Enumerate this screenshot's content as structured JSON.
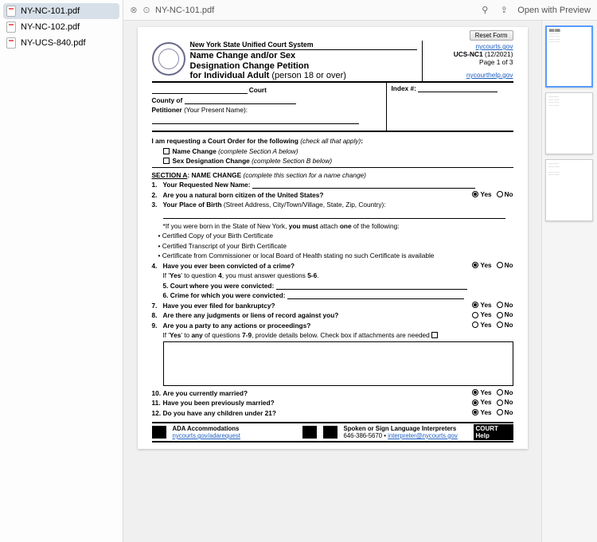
{
  "sidebar": {
    "files": [
      "NY-NC-101.pdf",
      "NY-NC-102.pdf",
      "NY-UCS-840.pdf"
    ],
    "selected": 0
  },
  "toolbar": {
    "doc_title": "NY-NC-101.pdf",
    "open_with": "Open with Preview"
  },
  "doc": {
    "reset": "Reset Form",
    "system": "New York State Unified Court System",
    "title_l1": "Name Change and/or Sex",
    "title_l2": "Designation Change Petition",
    "title_l3": "for Individual Adult",
    "title_l3_sub": " (person 18 or over)",
    "hdr_link1": "nycourts.gov",
    "form_code": "UCS-NC1",
    "form_date": " (12/2021)",
    "page_info": "Page 1 of 3",
    "hdr_link2": "nycourthelp.gov",
    "court_label": " Court",
    "county_label": "County of ",
    "petitioner_label": "Petitioner ",
    "petitioner_sub": "(Your Present Name):",
    "index_label": "Index #: ",
    "req_intro": "I am requesting a Court Order for the following ",
    "req_intro_sub": "(check all that apply)",
    "req_opt1": "Name Change ",
    "req_opt1_sub": "(complete Section A below)",
    "req_opt2": "Sex Designation Change ",
    "req_opt2_sub": "(complete Section B below)",
    "secA": "SECTION A",
    "secA_t": ": NAME CHANGE ",
    "secA_sub": "(complete this section for a name change)",
    "q1n": "1.",
    "q1": "Your Requested New Name: ",
    "q2n": "2.",
    "q2": "Are you a natural born citizen of the United States?",
    "q3n": "3.",
    "q3": "Your Place of Birth ",
    "q3_sub": "(Street Address, City/Town/Village, State, Zip, Country):",
    "born_note": "*If you were born in the State of New York, ",
    "born_note_b": "you must",
    "born_note2": " attach ",
    "born_note_b2": "one",
    "born_note3": " of the following:",
    "born_b1": "Certified Copy of your Birth Certificate",
    "born_b2": "Certified Transcript of your Birth Certificate",
    "born_b3": "Certificate from Commissioner or local Board of Health stating no such Certificate is available",
    "q4n": "4.",
    "q4": "Have you ever been convicted of a crime?",
    "q4_note": "If '",
    "q4_note_b": "Yes",
    "q4_note2": "' to question ",
    "q4_note_b2": "4",
    "q4_note3": ", you must answer questions ",
    "q4_note_b3": "5-6",
    "q4_note4": ".",
    "q5n": "5.",
    "q5": "Court where you were convicted: ",
    "q6n": "6.",
    "q6": "Crime for which you were convicted: ",
    "q7n": "7.",
    "q7": "Have you ever filed for bankruptcy?",
    "q8n": "8.",
    "q8": "Are there any judgments or liens of record against you?",
    "q9n": "9.",
    "q9": "Are you a party to any actions or proceedings?",
    "q9_note": "If '",
    "q9_note_b": "Yes",
    "q9_note2": "' to ",
    "q9_note_b2": "any",
    "q9_note3": " of questions ",
    "q9_note_b3": "7-9",
    "q9_note4": ", provide details below.   Check box if attachments are needed ",
    "q10n": "10.",
    "q10": "Are you currently married?",
    "q11n": "11.",
    "q11": "Have you been previously married?",
    "q12n": "12.",
    "q12": "Do you have any children under 21?",
    "yes": "Yes",
    "no": "No",
    "ada_t": "ADA Accommodations",
    "ada_link": "nycourts.gov/adarequest",
    "interp_t": "Spoken or Sign Language Interpreters",
    "interp_phone": "646-386-5670 • ",
    "interp_link": "interpreter@nycourts.gov",
    "court_help": "COURT Help",
    "answers": {
      "q2": "yes",
      "q4": "yes",
      "q7": "yes",
      "q8": null,
      "q9": null,
      "q10": "yes",
      "q11": "yes",
      "q12": "yes"
    }
  }
}
